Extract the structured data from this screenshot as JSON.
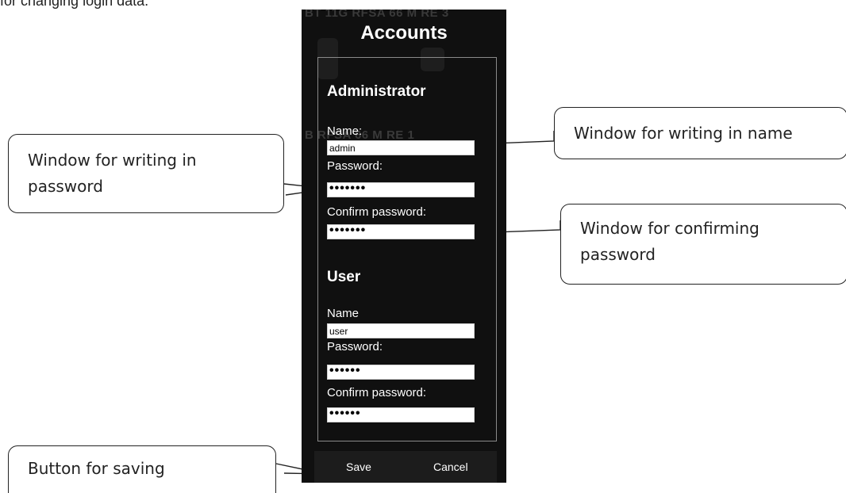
{
  "intro_text": "for changing login data.",
  "background_text": {
    "top": "BT 11G    RFSA 66 M RE 3",
    "middle": "B   RFSA 66 M RE 1"
  },
  "panel": {
    "title": "Accounts",
    "administrator": {
      "heading": "Administrator",
      "name_label": "Name:",
      "name_value": "admin",
      "password_label": "Password:",
      "password_value": "•••••••",
      "confirm_label": "Confirm password:",
      "confirm_value": "•••••••"
    },
    "user": {
      "heading": "User",
      "name_label": "Name",
      "name_value": "user",
      "password_label": "Password:",
      "password_value": "••••••",
      "confirm_label": "Confirm password:",
      "confirm_value": "••••••"
    },
    "save_label": "Save",
    "cancel_label": "Cancel"
  },
  "callouts": {
    "name_window": "Window for writing in name",
    "password_window": [
      "Window for writing in",
      "password"
    ],
    "confirm_window": [
      "Window for confirming",
      "password"
    ],
    "save_button": "Button for saving"
  }
}
